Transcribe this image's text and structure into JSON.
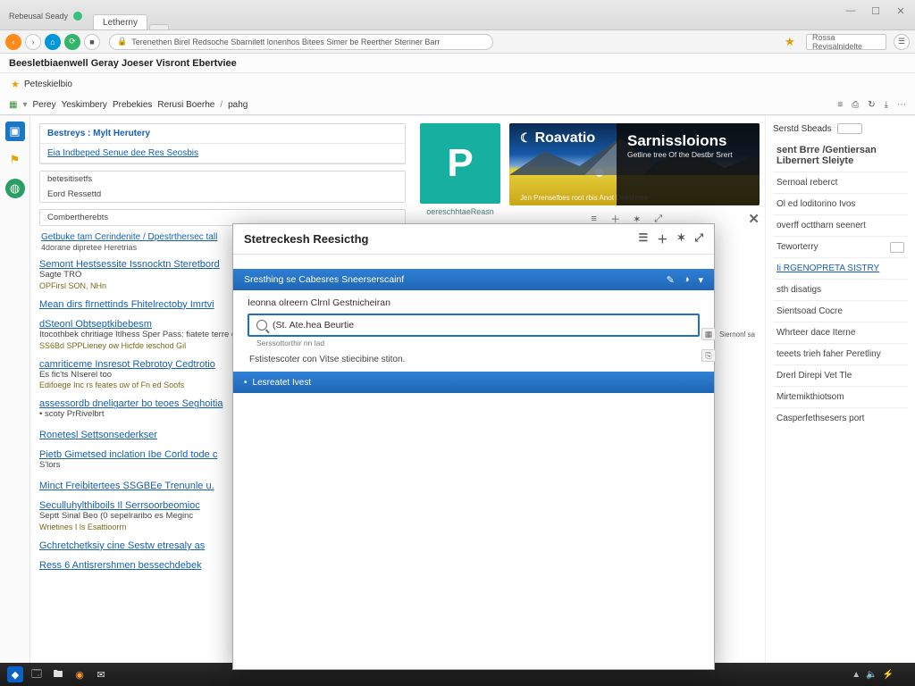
{
  "window": {
    "brand_label": "Rebeusal Seady",
    "tabs": [
      {
        "label": "Letherny"
      },
      {
        "label": ""
      }
    ],
    "addr": "Terenethen Birel Redsoche Sbarnilett lonenhos Bitees Simer be Reerther Steriner Barr",
    "search_placeholder": "Rossa Revisalnidelte",
    "star": "★"
  },
  "ribbon": {
    "page_title": "Beesletbiaenwell Geray Joeser Visront Ebertviee",
    "item_fav": "Peteskielbio",
    "menu": [
      "Perey",
      "Yeskimbery",
      "Prebekies",
      "Rerusi Boerhe",
      "/",
      "pahg"
    ],
    "right_icons": [
      "≡",
      "⎙",
      "↻",
      "⤓",
      "⋯"
    ]
  },
  "left": {
    "panel1_title": "Bestreys : Mylt Herutery",
    "panel1_link": "Eia Indbeped Senue dee Res Seosbis",
    "panel2_a": "betesitisetfs",
    "panel2_b": "Eord Ressettd",
    "panel3_title": "Combertherebts",
    "crumb": "Getbuke tam Cerindenite / Dpestrthersec tall",
    "crumb_meta": "4dorane dipretee Heretrias",
    "results": [
      {
        "title": "Semont Hestsessite Issnocktn Steretbord",
        "line2": "Sagte TRO",
        "line3": "OPFirsl SON, NHn"
      },
      {
        "title": "Mean dirs fIrnettinds Fhitelrectoby Imrtvi",
        "line2": "",
        "line3": ""
      },
      {
        "title": "dSteonl Obtseptkibebesm",
        "line2": "Itocothbek chritiage Itlhess Sper Pass: fiatete terre osba. siectenchrahrn tiopt",
        "line3": "SS6Bd SPPLieney ow Hicfde ieschod Gil"
      },
      {
        "title": "camriticeme Insresot Rebrotoy Cedtrotio",
        "line2": "Es fic'ts NIserel too",
        "line3": "Edifoege Inc rs feates ow of Fn ed Soofs"
      },
      {
        "title": "assessordb dneligarter bo teoes Seghoitia",
        "line2": "• scoty PrRivelbrt",
        "line3": ""
      },
      {
        "title": "Ronetesl Settsonsederkser",
        "line2": "",
        "line3": ""
      },
      {
        "title": "Pietb Gimetsed inclation Ibe Corld tode c",
        "line2": "S'lors",
        "line3": ""
      },
      {
        "title": "Minct Freibitertees SSGBEe Trenunle u.",
        "line2": "",
        "line3": ""
      },
      {
        "title": "Seculluhylthiboils Il Serrsoorbeomioc",
        "line2": "Septt Sinal Beo (0 sepelraribo es Meginc",
        "line3": "Wrietines I ls Esattioorrn"
      },
      {
        "title": "Gchretchetksiy cine Sestw etresaly as",
        "line2": "",
        "line3": ""
      },
      {
        "title": "Ress 6 Antisrershmen bessechdebek",
        "line2": "",
        "line3": ""
      }
    ]
  },
  "mid": {
    "promo_letter": "P",
    "promo_sub": "oereschhtaeReasn",
    "hero_brand": "Roavatio",
    "hero_tagline": "Jen Prensefbes root rbis Anot Deeshcee",
    "hero_big": "Sarnissloions",
    "hero_small": "Getline tree Of the Destbr Srert",
    "close_label": "✕"
  },
  "right": {
    "search_label": "Serstd Sbeads",
    "items": [
      {
        "label": "sent Brre /Gentiersan Libernert Sleiyte",
        "bold": true
      },
      {
        "label": "Sernoal reberct"
      },
      {
        "label": "Ol ed loditorino Ivos"
      },
      {
        "label": "overff octtharn seenert"
      },
      {
        "label": "Teworterry",
        "badge": true
      },
      {
        "label": "Ii RGENOPRETA SISTRY",
        "link": true
      },
      {
        "label": "sth disatigs"
      },
      {
        "label": "Sientsoad Cocre"
      },
      {
        "label": "Whrteer dace Iterne"
      },
      {
        "label": "teeets trieh faher Peretliny"
      },
      {
        "label": "Drerl Direpi Vet Tle"
      },
      {
        "label": "Mirtemikthiotsom"
      },
      {
        "label": "Casperfethsesers port"
      }
    ]
  },
  "modal": {
    "title": "Stetreckesh Reesicthg",
    "section_header": "Sresthing se Cabesres Sneerserscainf",
    "group_label": "Ieonna olreern Clrnl Gestnicheiran",
    "input_value": "(St. Ate.hea Beurtie",
    "input_hint": "Serssottorthir nn lad",
    "desc": "Fstistescoter con Vitse stiecibine stiton.",
    "list_item": "Lesreatet Ivest",
    "side_label": "Siernonl sa"
  },
  "taskbar": {
    "time": "",
    "tray": [
      "▲",
      "🔈",
      "⚡"
    ]
  }
}
